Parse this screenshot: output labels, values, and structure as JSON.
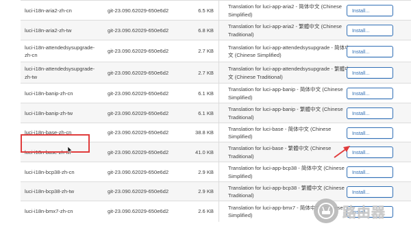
{
  "install_label": "Install...",
  "rows": [
    {
      "name": "luci-i18n-aria2-zh-cn",
      "version": "git-23.090.62029-650e6d2",
      "size": "6.5 KB",
      "description": "Translation for luci-app-aria2 - 简体中文 (Chinese Simplified)"
    },
    {
      "name": "luci-i18n-aria2-zh-tw",
      "version": "git-23.090.62029-650e6d2",
      "size": "6.8 KB",
      "description": "Translation for luci-app-aria2 - 繁體中文 (Chinese Traditional)"
    },
    {
      "name": "luci-i18n-attendedsysupgrade-zh-cn",
      "version": "git-23.090.62029-650e6d2",
      "size": "2.7 KB",
      "description": "Translation for luci-app-attendedsysupgrade - 简体中文 (Chinese Simplified)"
    },
    {
      "name": "luci-i18n-attendedsysupgrade-zh-tw",
      "version": "git-23.090.62029-650e6d2",
      "size": "2.7 KB",
      "description": "Translation for luci-app-attendedsysupgrade - 繁體中文 (Chinese Traditional)"
    },
    {
      "name": "luci-i18n-banip-zh-cn",
      "version": "git-23.090.62029-650e6d2",
      "size": "6.1 KB",
      "description": "Translation for luci-app-banip - 简体中文 (Chinese Simplified)"
    },
    {
      "name": "luci-i18n-banip-zh-tw",
      "version": "git-23.090.62029-650e6d2",
      "size": "6.1 KB",
      "description": "Translation for luci-app-banip - 繁體中文 (Chinese Traditional)"
    },
    {
      "name": "luci-i18n-base-zh-cn",
      "version": "git-23.090.62029-650e6d2",
      "size": "38.8 KB",
      "description": "Translation for luci-base - 简体中文 (Chinese Simplified)"
    },
    {
      "name": "luci-i18n-base-zh-tw",
      "version": "git-23.090.62029-650e6d2",
      "size": "41.0 KB",
      "description": "Translation for luci-base - 繁體中文 (Chinese Traditional)"
    },
    {
      "name": "luci-i18n-bcp38-zh-cn",
      "version": "git-23.090.62029-650e6d2",
      "size": "2.9 KB",
      "description": "Translation for luci-app-bcp38 - 简体中文 (Chinese Simplified)"
    },
    {
      "name": "luci-i18n-bcp38-zh-tw",
      "version": "git-23.090.62029-650e6d2",
      "size": "2.9 KB",
      "description": "Translation for luci-app-bcp38 - 繁體中文 (Chinese Traditional)"
    },
    {
      "name": "luci-i18n-bmx7-zh-cn",
      "version": "git-23.090.62029-650e6d2",
      "size": "2.6 KB",
      "description": "Translation for luci-app-bmx7 - 简体中文 (Chinese Simplified)"
    }
  ],
  "watermark": {
    "text": "路由器",
    "icon": "router-icon"
  },
  "colors": {
    "button_accent": "#2f6eb5",
    "highlight": "#e03b3b"
  }
}
